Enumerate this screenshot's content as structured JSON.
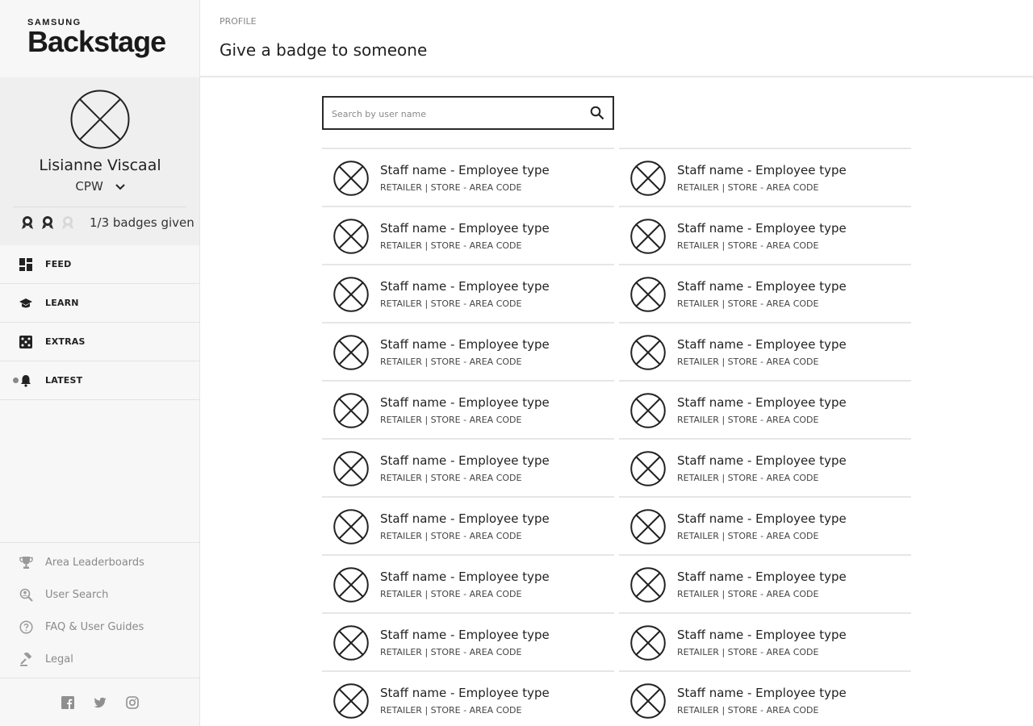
{
  "brand": {
    "small": "SAMSUNG",
    "big": "Backstage"
  },
  "profile": {
    "name": "Lisianne Viscaal",
    "role": "CPW",
    "badges_text": "1/3 badges given",
    "badges_given": 1,
    "badges_total": 3
  },
  "nav": [
    {
      "label": "FEED",
      "icon": "dashboard-icon"
    },
    {
      "label": "LEARN",
      "icon": "graduation-cap-icon"
    },
    {
      "label": "EXTRAS",
      "icon": "dice-icon"
    },
    {
      "label": "LATEST",
      "icon": "bell-icon",
      "has_dot": true
    }
  ],
  "footer_links": [
    {
      "label": "Area Leaderboards",
      "icon": "trophy-icon"
    },
    {
      "label": "User Search",
      "icon": "user-search-icon"
    },
    {
      "label": "FAQ & User Guides",
      "icon": "help-icon"
    },
    {
      "label": "Legal",
      "icon": "gavel-icon"
    }
  ],
  "social": [
    "facebook-icon",
    "twitter-icon",
    "instagram-icon"
  ],
  "header": {
    "breadcrumb": "PROFILE",
    "title": "Give a badge to someone"
  },
  "search": {
    "placeholder": "Search by user name",
    "value": ""
  },
  "staff": [
    {
      "name": "Staff name - Employee type",
      "sub": "RETAILER | STORE - AREA CODE"
    },
    {
      "name": "Staff name - Employee type",
      "sub": "RETAILER | STORE - AREA CODE"
    },
    {
      "name": "Staff name - Employee type",
      "sub": "RETAILER | STORE - AREA CODE"
    },
    {
      "name": "Staff name - Employee type",
      "sub": "RETAILER | STORE - AREA CODE"
    },
    {
      "name": "Staff name - Employee type",
      "sub": "RETAILER | STORE - AREA CODE"
    },
    {
      "name": "Staff name - Employee type",
      "sub": "RETAILER | STORE - AREA CODE"
    },
    {
      "name": "Staff name - Employee type",
      "sub": "RETAILER | STORE - AREA CODE"
    },
    {
      "name": "Staff name - Employee type",
      "sub": "RETAILER | STORE - AREA CODE"
    },
    {
      "name": "Staff name - Employee type",
      "sub": "RETAILER | STORE - AREA CODE"
    },
    {
      "name": "Staff name - Employee type",
      "sub": "RETAILER | STORE - AREA CODE"
    },
    {
      "name": "Staff name - Employee type",
      "sub": "RETAILER | STORE - AREA CODE"
    },
    {
      "name": "Staff name - Employee type",
      "sub": "RETAILER | STORE - AREA CODE"
    },
    {
      "name": "Staff name - Employee type",
      "sub": "RETAILER | STORE - AREA CODE"
    },
    {
      "name": "Staff name - Employee type",
      "sub": "RETAILER | STORE - AREA CODE"
    },
    {
      "name": "Staff name - Employee type",
      "sub": "RETAILER | STORE - AREA CODE"
    },
    {
      "name": "Staff name - Employee type",
      "sub": "RETAILER | STORE - AREA CODE"
    },
    {
      "name": "Staff name - Employee type",
      "sub": "RETAILER | STORE - AREA CODE"
    },
    {
      "name": "Staff name - Employee type",
      "sub": "RETAILER | STORE - AREA CODE"
    },
    {
      "name": "Staff name - Employee type",
      "sub": "RETAILER | STORE - AREA CODE"
    },
    {
      "name": "Staff name - Employee type",
      "sub": "RETAILER | STORE - AREA CODE"
    }
  ]
}
